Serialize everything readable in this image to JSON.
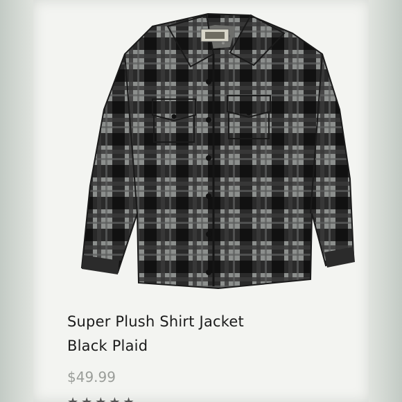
{
  "product": {
    "title_line1": "Super Plush Shirt Jacket",
    "title_line2": "Black Plaid",
    "price": "$49.99",
    "image_icon": "plaid-shirt-jacket-image",
    "rating_icon": "star-rating-icon"
  },
  "colors": {
    "plaid_dark": "#1f1f1f",
    "plaid_mid": "#4b4b4b",
    "plaid_light": "#8c8f8d",
    "price_gray": "#9a9d99"
  }
}
